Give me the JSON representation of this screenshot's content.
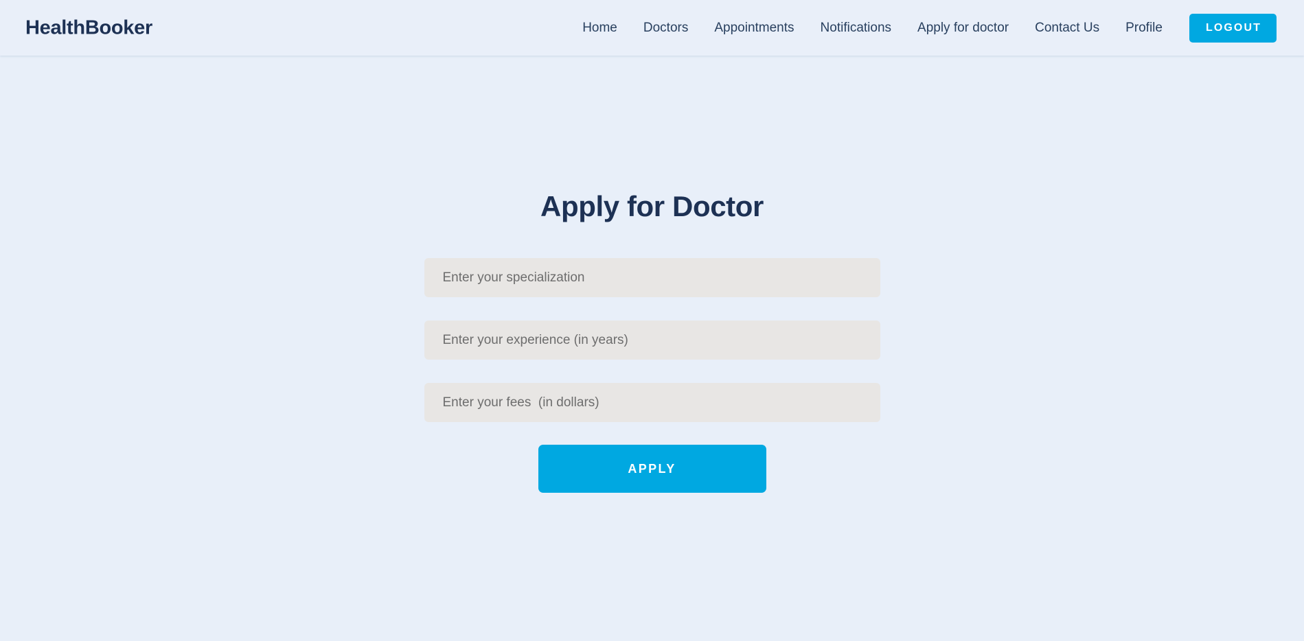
{
  "header": {
    "logo": "HealthBooker",
    "nav_items": [
      {
        "label": "Home"
      },
      {
        "label": "Doctors"
      },
      {
        "label": "Appointments"
      },
      {
        "label": "Notifications"
      },
      {
        "label": "Apply for doctor"
      },
      {
        "label": "Contact Us"
      },
      {
        "label": "Profile"
      }
    ],
    "logout_label": "LOGOUT"
  },
  "main": {
    "title": "Apply for Doctor",
    "form": {
      "specialization": {
        "value": "",
        "placeholder": "Enter your specialization"
      },
      "experience": {
        "value": "",
        "placeholder": "Enter your experience (in years)"
      },
      "fees": {
        "value": "",
        "placeholder": "Enter your fees  (in dollars)"
      },
      "submit_label": "APPLY"
    }
  },
  "colors": {
    "accent": "#00a8e1",
    "page_background": "#e8eff9",
    "heading": "#1d3154",
    "input_background": "#e8e6e4",
    "nav_text": "#29405f"
  }
}
